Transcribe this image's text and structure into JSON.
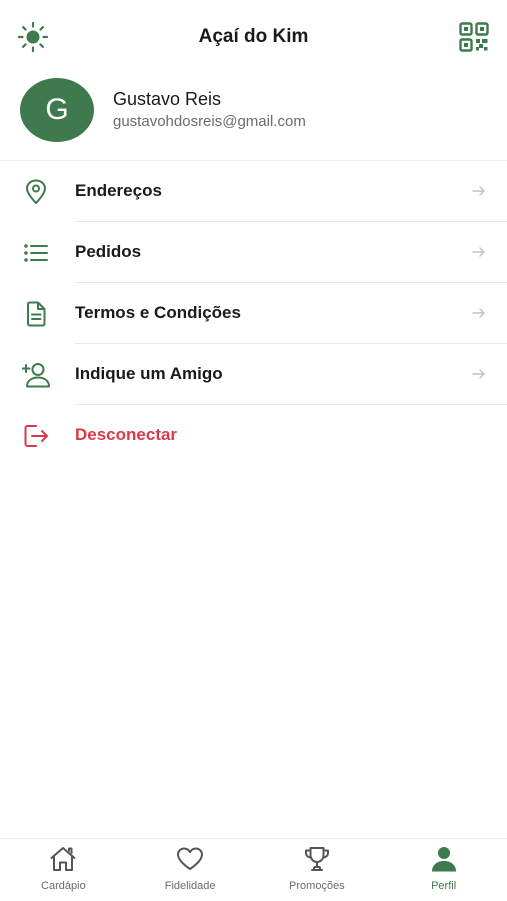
{
  "header": {
    "title": "Açaí do Kim",
    "left_icon": "sun-icon",
    "right_icon": "qr-code-icon"
  },
  "profile": {
    "initial": "G",
    "name": "Gustavo Reis",
    "email": "gustavohdosreis@gmail.com"
  },
  "menu": {
    "items": [
      {
        "label": "Endereços",
        "icon": "location-pin-icon"
      },
      {
        "label": "Pedidos",
        "icon": "list-icon"
      },
      {
        "label": "Termos e Condições",
        "icon": "document-icon"
      },
      {
        "label": "Indique um Amigo",
        "icon": "add-user-icon"
      },
      {
        "label": "Desconectar",
        "icon": "logout-icon"
      }
    ]
  },
  "tabs": [
    {
      "label": "Cardápio",
      "icon": "home-icon",
      "active": false
    },
    {
      "label": "Fidelidade",
      "icon": "heart-icon",
      "active": false
    },
    {
      "label": "Promoções",
      "icon": "trophy-icon",
      "active": false
    },
    {
      "label": "Perfil",
      "icon": "user-icon",
      "active": true
    }
  ],
  "colors": {
    "accent": "#3f7a4e",
    "danger": "#d83a48",
    "text": "#1a1a1a",
    "muted": "#6b6b6b"
  }
}
